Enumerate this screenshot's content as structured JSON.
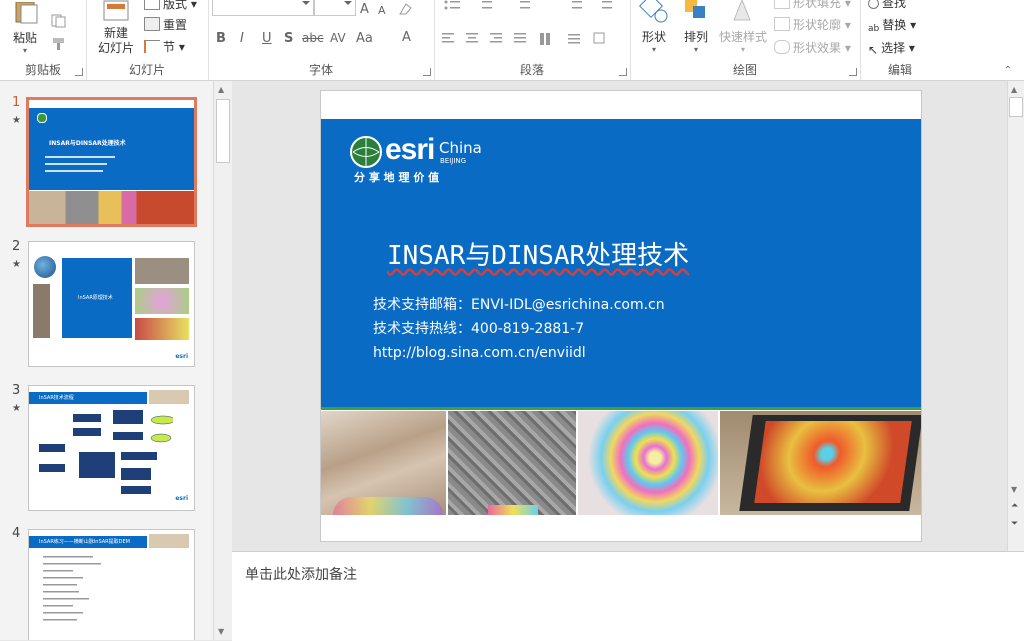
{
  "ribbon": {
    "clipboard": {
      "paste": "粘贴",
      "label": "剪贴板"
    },
    "slides": {
      "new_slide": "新建\n幻灯片",
      "layout": "版式",
      "reset": "重置",
      "section": "节",
      "label": "幻灯片"
    },
    "font": {
      "bold": "B",
      "italic": "I",
      "underline": "U",
      "shadow": "S",
      "strike": "abc",
      "spacing": "AV",
      "case": "Aa",
      "color": "A",
      "grow": "A",
      "shrink": "A",
      "label": "字体"
    },
    "paragraph": {
      "label": "段落"
    },
    "drawing": {
      "shapes": "形状",
      "arrange": "排列",
      "quick_styles": "快速样式",
      "fill": "形状填充",
      "outline": "形状轮廓",
      "effects": "形状效果",
      "label": "绘图"
    },
    "editing": {
      "find": "查找",
      "replace": "替换",
      "select": "选择",
      "label": "编辑"
    }
  },
  "thumbnails": [
    {
      "num": "1",
      "title": "INSAR与DINSAR处理技术"
    },
    {
      "num": "2",
      "title": "InSAR原理技术"
    },
    {
      "num": "3",
      "title": "InSAR技术流程"
    },
    {
      "num": "4",
      "title": "InSAR练习——横断山脉InSAR提取DEM"
    }
  ],
  "slide": {
    "brand": "esri",
    "brand_sub": "China",
    "brand_city": "BEIJING",
    "slogan": "分 享 地 理 价 值",
    "title": "INSAR与DINSAR处理技术",
    "email_line": "技术支持邮箱：ENVI-IDL@esrichina.com.cn",
    "phone_line": "技术支持热线：400-819-2881-7",
    "url_line": "http://blog.sina.com.cn/enviidl"
  },
  "notes": {
    "placeholder": "单击此处添加备注"
  },
  "colors": {
    "slide_blue": "#0a6bc4",
    "accent_selected": "#e07a5f"
  }
}
